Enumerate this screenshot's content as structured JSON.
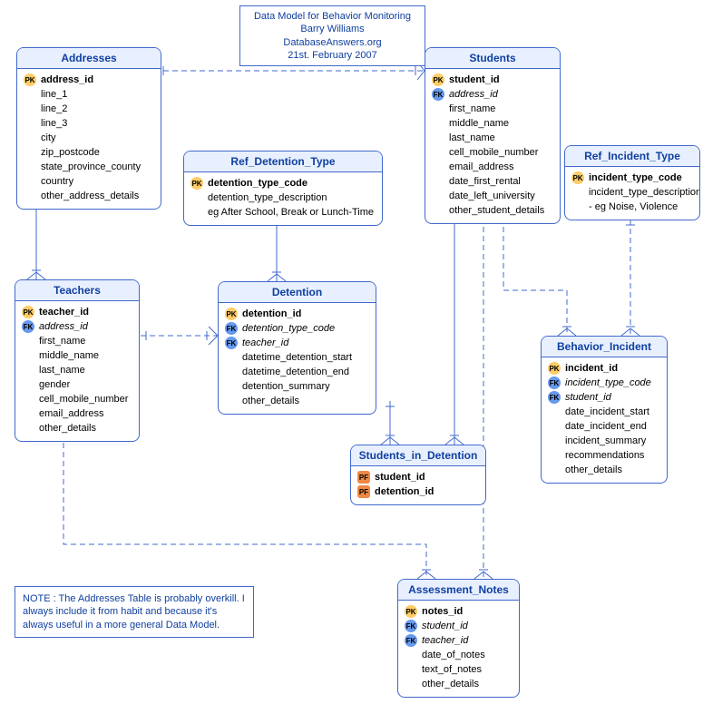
{
  "title": {
    "line1": "Data Model for Behavior Monitoring",
    "line2": "Barry Williams",
    "line3": "DatabaseAnswers.org",
    "line4": "21st. February 2007"
  },
  "note": {
    "text": "NOTE : The Addresses Table is probably overkill. I always include it from habit and because it's always useful in a more general Data Model."
  },
  "entities": {
    "addresses": {
      "title": "Addresses",
      "fields": [
        {
          "key": "PK",
          "name": "address_id",
          "bold": true
        },
        {
          "key": "",
          "name": "line_1"
        },
        {
          "key": "",
          "name": "line_2"
        },
        {
          "key": "",
          "name": "line_3"
        },
        {
          "key": "",
          "name": "city"
        },
        {
          "key": "",
          "name": "zip_postcode"
        },
        {
          "key": "",
          "name": "state_province_county"
        },
        {
          "key": "",
          "name": "country"
        },
        {
          "key": "",
          "name": "other_address_details"
        }
      ]
    },
    "students": {
      "title": "Students",
      "fields": [
        {
          "key": "PK",
          "name": "student_id",
          "bold": true
        },
        {
          "key": "FK",
          "name": "address_id",
          "italic": true
        },
        {
          "key": "",
          "name": "first_name"
        },
        {
          "key": "",
          "name": "middle_name"
        },
        {
          "key": "",
          "name": "last_name"
        },
        {
          "key": "",
          "name": "cell_mobile_number"
        },
        {
          "key": "",
          "name": "email_address"
        },
        {
          "key": "",
          "name": "date_first_rental"
        },
        {
          "key": "",
          "name": "date_left_university"
        },
        {
          "key": "",
          "name": "other_student_details"
        }
      ]
    },
    "ref_incident_type": {
      "title": "Ref_Incident_Type",
      "fields": [
        {
          "key": "PK",
          "name": "incident_type_code",
          "bold": true
        },
        {
          "key": "",
          "name": "incident_type_description"
        },
        {
          "key": "",
          "name": "- eg Noise, Violence"
        }
      ]
    },
    "ref_detention_type": {
      "title": "Ref_Detention_Type",
      "fields": [
        {
          "key": "PK",
          "name": "detention_type_code",
          "bold": true
        },
        {
          "key": "",
          "name": "detention_type_description"
        },
        {
          "key": "",
          "name": "eg After School, Break or Lunch-Time"
        }
      ]
    },
    "teachers": {
      "title": "Teachers",
      "fields": [
        {
          "key": "PK",
          "name": "teacher_id",
          "bold": true
        },
        {
          "key": "FK",
          "name": "address_id",
          "italic": true
        },
        {
          "key": "",
          "name": "first_name"
        },
        {
          "key": "",
          "name": "middle_name"
        },
        {
          "key": "",
          "name": "last_name"
        },
        {
          "key": "",
          "name": "gender"
        },
        {
          "key": "",
          "name": "cell_mobile_number"
        },
        {
          "key": "",
          "name": "email_address"
        },
        {
          "key": "",
          "name": "other_details"
        }
      ]
    },
    "detention": {
      "title": "Detention",
      "fields": [
        {
          "key": "PK",
          "name": "detention_id",
          "bold": true
        },
        {
          "key": "FK",
          "name": "detention_type_code",
          "italic": true
        },
        {
          "key": "FK",
          "name": "teacher_id",
          "italic": true
        },
        {
          "key": "",
          "name": "datetime_detention_start"
        },
        {
          "key": "",
          "name": "datetime_detention_end"
        },
        {
          "key": "",
          "name": "detention_summary"
        },
        {
          "key": "",
          "name": "other_details"
        }
      ]
    },
    "behavior_incident": {
      "title": "Behavior_Incident",
      "fields": [
        {
          "key": "PK",
          "name": "incident_id",
          "bold": true
        },
        {
          "key": "FK",
          "name": "incident_type_code",
          "italic": true
        },
        {
          "key": "FK",
          "name": "student_id",
          "italic": true
        },
        {
          "key": "",
          "name": "date_incident_start"
        },
        {
          "key": "",
          "name": "date_incident_end"
        },
        {
          "key": "",
          "name": "incident_summary"
        },
        {
          "key": "",
          "name": "recommendations"
        },
        {
          "key": "",
          "name": "other_details"
        }
      ]
    },
    "students_in_detention": {
      "title": "Students_in_Detention",
      "fields": [
        {
          "key": "PF",
          "name": "student_id",
          "bold": true
        },
        {
          "key": "PF",
          "name": "detention_id",
          "bold": true
        }
      ]
    },
    "assessment_notes": {
      "title": "Assessment_Notes",
      "fields": [
        {
          "key": "PK",
          "name": "notes_id",
          "bold": true
        },
        {
          "key": "FK",
          "name": "student_id",
          "italic": true
        },
        {
          "key": "FK",
          "name": "teacher_id",
          "italic": true
        },
        {
          "key": "",
          "name": "date_of_notes"
        },
        {
          "key": "",
          "name": "text_of_notes"
        },
        {
          "key": "",
          "name": "other_details"
        }
      ]
    }
  }
}
